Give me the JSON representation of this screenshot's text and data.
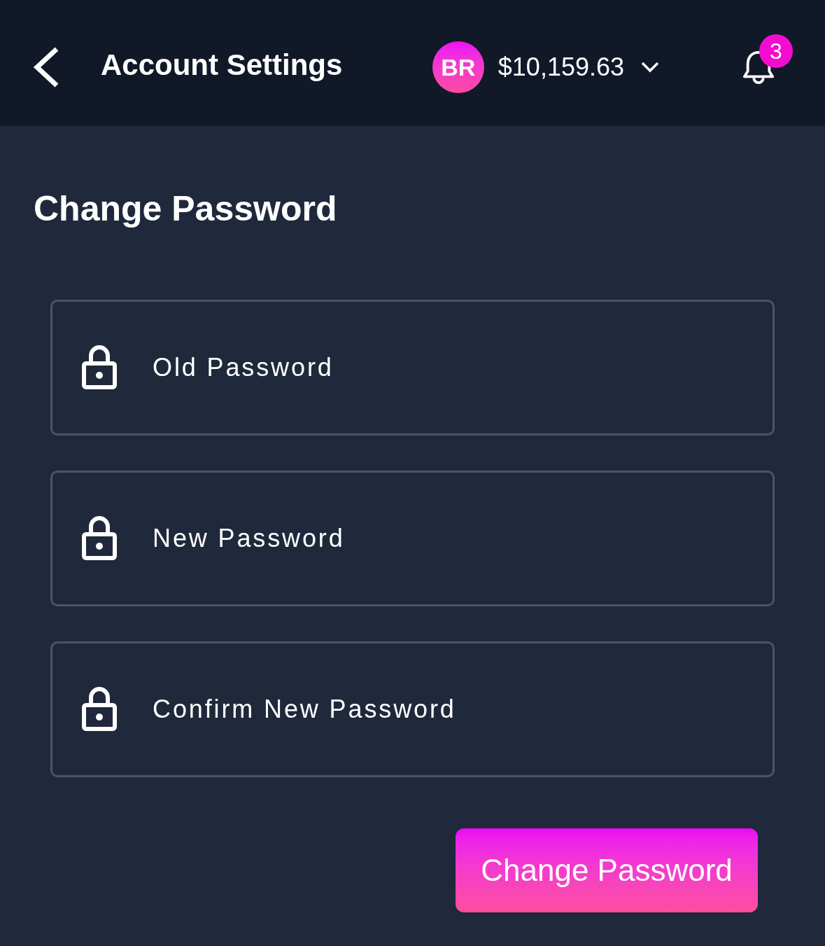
{
  "header": {
    "title": "Account Settings",
    "avatar_initials": "BR",
    "balance": "$10,159.63",
    "notification_count": "3"
  },
  "section": {
    "title": "Change Password"
  },
  "fields": [
    {
      "placeholder": "Old Password"
    },
    {
      "placeholder": "New Password"
    },
    {
      "placeholder": "Confirm New Password"
    }
  ],
  "submit_button": {
    "label": "Change Password"
  }
}
